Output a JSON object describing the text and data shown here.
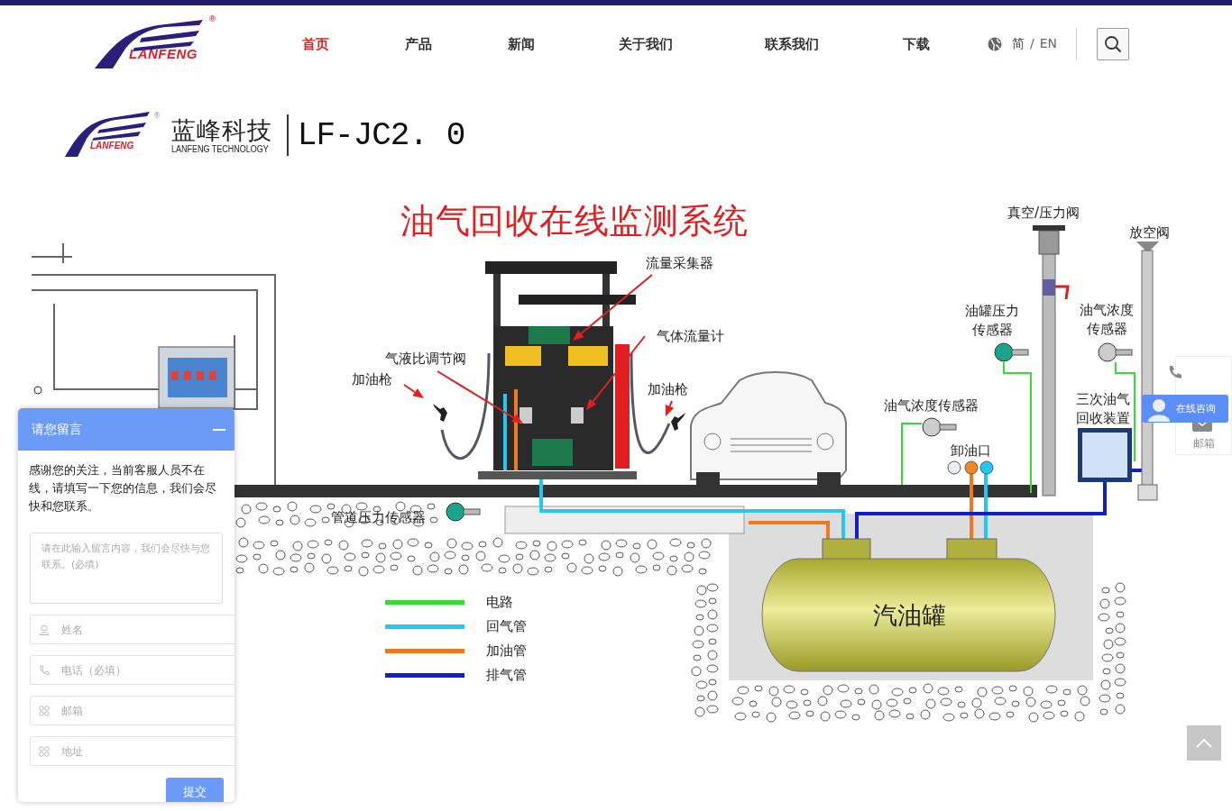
{
  "header": {
    "logo": {
      "text": "LANFENG",
      "mark": "®"
    },
    "nav": [
      {
        "label": "首页",
        "selected": true
      },
      {
        "label": "产品",
        "selected": false
      },
      {
        "label": "新闻",
        "selected": false
      },
      {
        "label": "关于我们",
        "selected": false
      },
      {
        "label": "联系我们",
        "selected": false
      },
      {
        "label": "下载",
        "selected": false
      }
    ],
    "languages": [
      {
        "label": "简",
        "selected": true
      },
      {
        "label": "EN",
        "selected": false
      }
    ],
    "language_separator": "/"
  },
  "diagram": {
    "brand": {
      "name": "蓝峰科技",
      "subtitle": "LANFENG TECHNOLOGY",
      "logo_text": "LANFENG",
      "mark": "®",
      "model": "LF-JC2. 0"
    },
    "title": "油气回收在线监测系统",
    "labels": [
      {
        "text": "真空/压力阀"
      },
      {
        "text": "放空阀"
      },
      {
        "text": "流量采集器"
      },
      {
        "text": "油罐压力传感器"
      },
      {
        "text": "油气浓度传感器"
      },
      {
        "text": "气体流量计"
      },
      {
        "text": "气液比调节阀"
      },
      {
        "text": "加油枪"
      },
      {
        "text": "加油枪"
      },
      {
        "text": "油气浓度传感器"
      },
      {
        "text": "三次油气回收装置"
      },
      {
        "text": "卸油口"
      },
      {
        "text": "管道压力传感器"
      }
    ],
    "tank_label": "汽油罐",
    "legend": [
      {
        "label": "电路",
        "color": "#33dd33"
      },
      {
        "label": "回气管",
        "color": "#22c8f0"
      },
      {
        "label": "加油管",
        "color": "#f07820"
      },
      {
        "label": "排气管",
        "color": "#1020c8"
      }
    ]
  },
  "chat": {
    "title": "请您留言",
    "message": "感谢您的关注，当前客服人员不在线，请填写一下您的信息，我们会尽快和您联系。",
    "message_placeholder": "请在此输入留言内容，我们会尽快与您联系。(必填)",
    "fields": [
      {
        "kind": "person",
        "placeholder": "姓名"
      },
      {
        "kind": "phone",
        "placeholder": "电话（必填）"
      },
      {
        "kind": "grid",
        "placeholder": "邮箱"
      },
      {
        "kind": "grid",
        "placeholder": "地址"
      }
    ],
    "submit": "提交"
  },
  "side_tools": {
    "consult": "在线咨询",
    "email": "邮箱"
  }
}
